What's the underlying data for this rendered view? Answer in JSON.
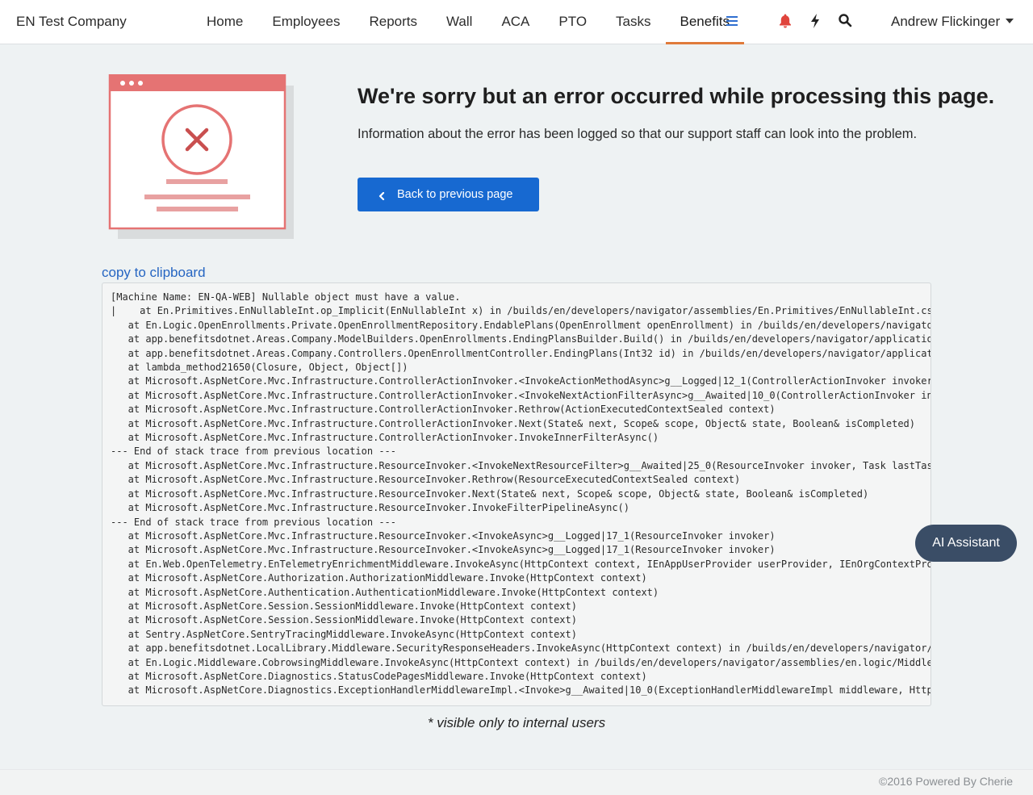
{
  "header": {
    "company": "EN Test Company",
    "nav": [
      {
        "label": "Home",
        "active": false
      },
      {
        "label": "Employees",
        "active": false
      },
      {
        "label": "Reports",
        "active": false
      },
      {
        "label": "Wall",
        "active": false
      },
      {
        "label": "ACA",
        "active": false
      },
      {
        "label": "PTO",
        "active": false
      },
      {
        "label": "Tasks",
        "active": false
      },
      {
        "label": "Benefits",
        "active": true
      }
    ],
    "icons": [
      "menu-icon",
      "bell-icon",
      "bolt-icon",
      "search-icon"
    ],
    "user_name": "Andrew Flickinger",
    "colors": {
      "accent": "#e07a3a",
      "bell": "#e0443c",
      "menu": "#2f6fd0"
    }
  },
  "error": {
    "title": "We're sorry but an error occurred while processing this page.",
    "subtitle": "Information about the error has been logged so that our support staff can look into the problem.",
    "back_button": "Back to previous page",
    "copy_link": "copy to clipboard",
    "note": "* visible only to internal users",
    "colors": {
      "button": "#1769d1",
      "illustration": "#e57373"
    }
  },
  "stack_trace": [
    "[Machine Name: EN-QA-WEB] Nullable object must have a value.",
    "|    at En.Primitives.EnNullableInt.op_Implicit(EnNullableInt x) in /builds/en/developers/navigator/assemblies/En.Primitives/EnNullableInt.cs:line",
    "   at En.Logic.OpenEnrollments.Private.OpenEnrollmentRepository.EndablePlans(OpenEnrollment openEnrollment) in /builds/en/developers/navigator/assemblies/en.logic",
    "   at app.benefitsdotnet.Areas.Company.ModelBuilders.OpenEnrollments.EndingPlansBuilder.Build() in /builds/en/developers/navigator/applications/app.benefits",
    "   at app.benefitsdotnet.Areas.Company.Controllers.OpenEnrollmentController.EndingPlans(Int32 id) in /builds/en/developers/navigator/applications/app.benefits",
    "   at lambda_method21650(Closure, Object, Object[])",
    "   at Microsoft.AspNetCore.Mvc.Infrastructure.ControllerActionInvoker.<InvokeActionMethodAsync>g__Logged|12_1(ControllerActionInvoker invoker)",
    "   at Microsoft.AspNetCore.Mvc.Infrastructure.ControllerActionInvoker.<InvokeNextActionFilterAsync>g__Awaited|10_0(ControllerActionInvoker invoker, Task lastTask, State next",
    "   at Microsoft.AspNetCore.Mvc.Infrastructure.ControllerActionInvoker.Rethrow(ActionExecutedContextSealed context)",
    "   at Microsoft.AspNetCore.Mvc.Infrastructure.ControllerActionInvoker.Next(State& next, Scope& scope, Object& state, Boolean& isCompleted)",
    "   at Microsoft.AspNetCore.Mvc.Infrastructure.ControllerActionInvoker.InvokeInnerFilterAsync()",
    "--- End of stack trace from previous location ---",
    "   at Microsoft.AspNetCore.Mvc.Infrastructure.ResourceInvoker.<InvokeNextResourceFilter>g__Awaited|25_0(ResourceInvoker invoker, Task lastTask, State next",
    "   at Microsoft.AspNetCore.Mvc.Infrastructure.ResourceInvoker.Rethrow(ResourceExecutedContextSealed context)",
    "   at Microsoft.AspNetCore.Mvc.Infrastructure.ResourceInvoker.Next(State& next, Scope& scope, Object& state, Boolean& isCompleted)",
    "   at Microsoft.AspNetCore.Mvc.Infrastructure.ResourceInvoker.InvokeFilterPipelineAsync()",
    "--- End of stack trace from previous location ---",
    "   at Microsoft.AspNetCore.Mvc.Infrastructure.ResourceInvoker.<InvokeAsync>g__Logged|17_1(ResourceInvoker invoker)",
    "   at Microsoft.AspNetCore.Mvc.Infrastructure.ResourceInvoker.<InvokeAsync>g__Logged|17_1(ResourceInvoker invoker)",
    "   at En.Web.OpenTelemetry.EnTelemetryEnrichmentMiddleware.InvokeAsync(HttpContext context, IEnAppUserProvider userProvider, IEnOrgContextProvider",
    "   at Microsoft.AspNetCore.Authorization.AuthorizationMiddleware.Invoke(HttpContext context)",
    "   at Microsoft.AspNetCore.Authentication.AuthenticationMiddleware.Invoke(HttpContext context)",
    "   at Microsoft.AspNetCore.Session.SessionMiddleware.Invoke(HttpContext context)",
    "   at Microsoft.AspNetCore.Session.SessionMiddleware.Invoke(HttpContext context)",
    "   at Sentry.AspNetCore.SentryTracingMiddleware.InvokeAsync(HttpContext context)",
    "   at app.benefitsdotnet.LocalLibrary.Middleware.SecurityResponseHeaders.InvokeAsync(HttpContext context) in /builds/en/developers/navigator/applications",
    "   at En.Logic.Middleware.CobrowsingMiddleware.InvokeAsync(HttpContext context) in /builds/en/developers/navigator/assemblies/en.logic/Middleware",
    "   at Microsoft.AspNetCore.Diagnostics.StatusCodePagesMiddleware.Invoke(HttpContext context)",
    "   at Microsoft.AspNetCore.Diagnostics.ExceptionHandlerMiddlewareImpl.<Invoke>g__Awaited|10_0(ExceptionHandlerMiddlewareImpl middleware, HttpContext"
  ],
  "ai_assistant": "AI Assistant",
  "footer": "©2016 Powered By Cherie"
}
